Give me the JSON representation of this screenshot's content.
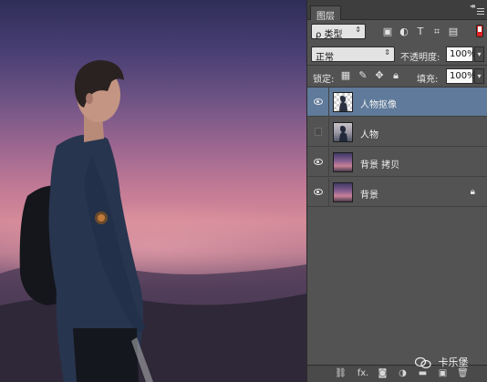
{
  "panel": {
    "tab_label": "图层",
    "collapse_glyph": "◂◂",
    "filter_kind_label": "ρ 类型",
    "blend_mode": "正常",
    "opacity_label": "不透明度:",
    "opacity_value": "100%",
    "lock_label": "锁定:",
    "fill_label": "填充:",
    "fill_value": "100%"
  },
  "layers": [
    {
      "name": "人物抠像",
      "visible": true,
      "selected": true,
      "thumb": "transparent-cutout"
    },
    {
      "name": "人物",
      "visible": false,
      "selected": false,
      "thumb": "person-photo"
    },
    {
      "name": "背景 拷贝",
      "visible": true,
      "selected": false,
      "thumb": "sky"
    },
    {
      "name": "背景",
      "visible": true,
      "selected": false,
      "thumb": "sky",
      "locked": true
    }
  ],
  "bottom_icons": [
    "link-icon",
    "fx-icon",
    "mask-icon",
    "adjustment-icon",
    "group-folder-icon",
    "new-layer-icon",
    "trash-icon"
  ],
  "bottom_fx_label": "fx.",
  "watermark": {
    "text": "卡乐堡"
  },
  "colors": {
    "selected_layer": "#5f7a9a",
    "panel_bg": "#535353",
    "toggle_red": "#dd2222"
  }
}
